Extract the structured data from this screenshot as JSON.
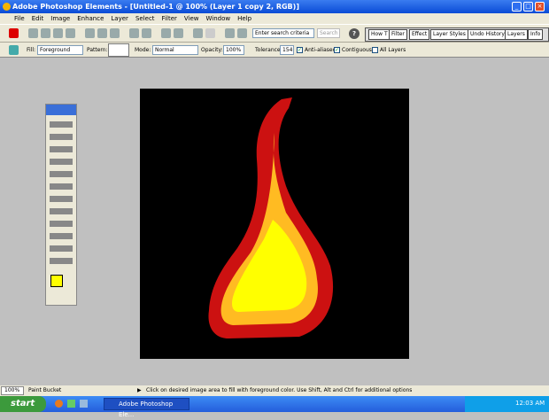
{
  "window": {
    "title": "Adobe Photoshop Elements - [Untitled-1 @ 100% (Layer 1 copy 2, RGB)]"
  },
  "menu": [
    "File",
    "Edit",
    "Image",
    "Enhance",
    "Layer",
    "Select",
    "Filter",
    "View",
    "Window",
    "Help"
  ],
  "toolbar": {
    "search_placeholder": "Enter search criteria",
    "search_button": "Search",
    "help_icon": "?"
  },
  "palette_tabs": [
    "How T",
    "Filter",
    "Effect",
    "Layer Styles",
    "Undo History",
    "Layers",
    "Info"
  ],
  "options": {
    "fill_label": "Fill:",
    "fill_value": "Foreground",
    "pattern_label": "Pattern:",
    "mode_label": "Mode:",
    "mode_value": "Normal",
    "opacity_label": "Opacity:",
    "opacity_value": "100%",
    "tolerance_label": "Tolerance:",
    "tolerance_value": "154",
    "anti_aliased": "Anti-aliased",
    "contiguous": "Contiguous",
    "all_layers": "All Layers",
    "anti_aliased_checked": true,
    "contiguous_checked": true,
    "all_layers_checked": false
  },
  "colors": {
    "foreground": "#ffff00",
    "background": "#ffffff",
    "flame_outer": "#cc1111",
    "flame_mid": "#ffbb22",
    "flame_core": "#ffff00"
  },
  "status": {
    "zoom": "100%",
    "tool": "Paint Bucket",
    "hint": "Click on desired image area to fill with foreground color.  Use Shift, Alt and Ctrl for additional options"
  },
  "taskbar": {
    "start": "start",
    "task": "Adobe Photoshop Ele...",
    "clock": "12:03 AM"
  }
}
